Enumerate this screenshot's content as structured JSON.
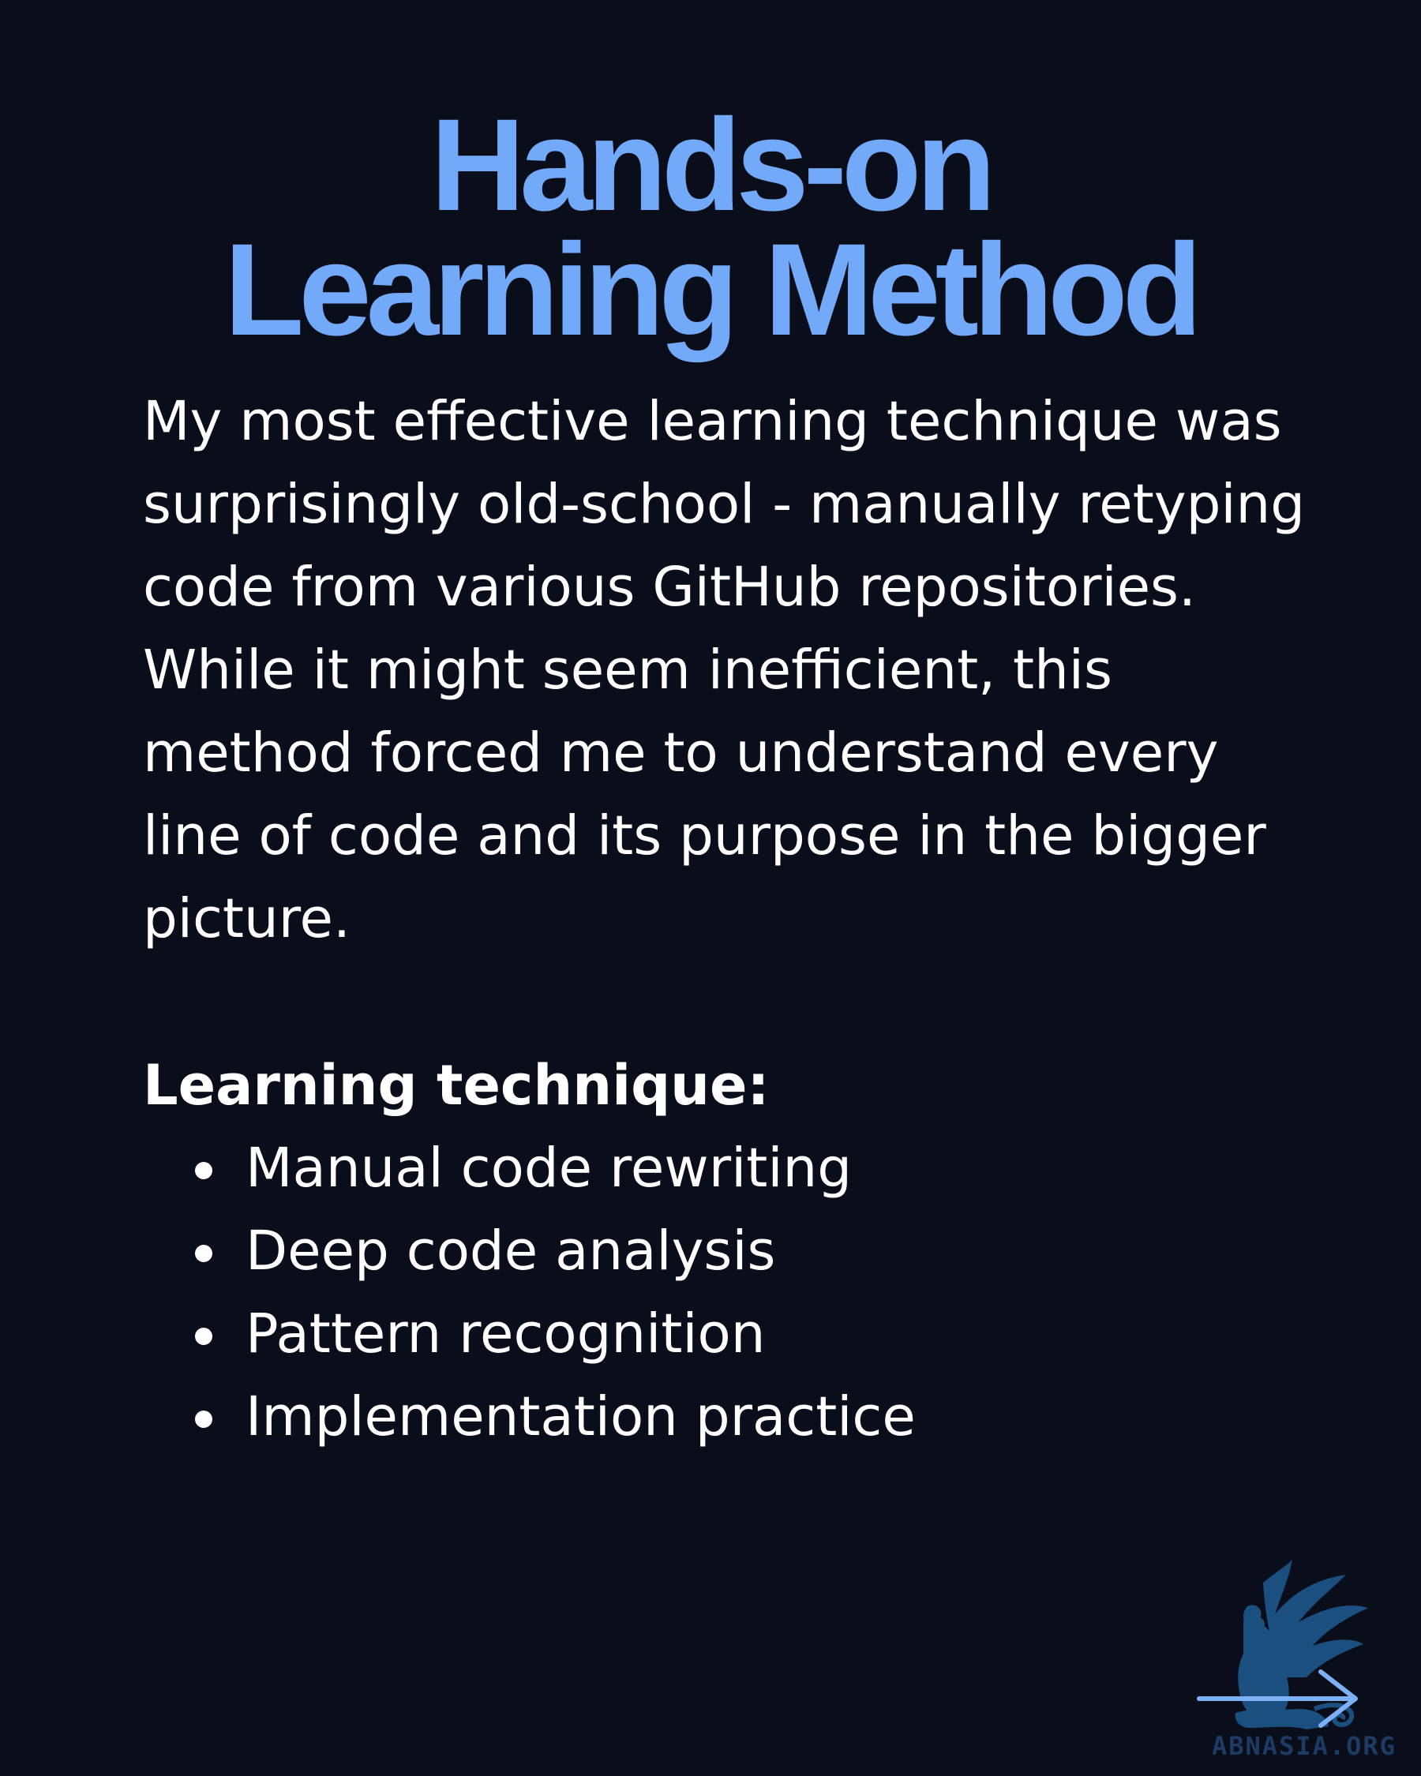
{
  "title": {
    "line1": "Hands-on",
    "line2": "Learning Method"
  },
  "body": {
    "paragraph": "My most effective learning technique was surprisingly old-school - manually retyping code from various GitHub repositories. While it might seem inefficient, this method forced me to understand every line of code and its purpose in the bigger picture."
  },
  "technique": {
    "heading": "Learning technique:",
    "items": [
      "Manual code rewriting",
      "Deep code analysis",
      "Pattern recognition",
      "Implementation practice"
    ]
  },
  "branding": {
    "watermark": "ABNASIA.ORG",
    "logo_icon": "griffin-logo-icon",
    "next_icon": "arrow-right-icon"
  },
  "colors": {
    "background": "#0a0e1a",
    "title": "#72a9f8",
    "text": "#ffffff",
    "logo": "#1a4f80",
    "arrow": "#7db0f5"
  }
}
